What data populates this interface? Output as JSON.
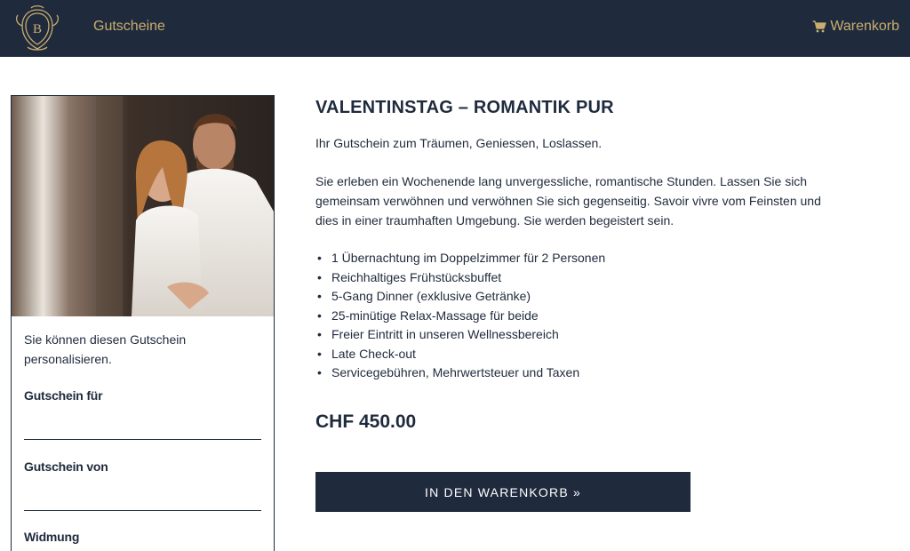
{
  "colors": {
    "nav_bg": "#1f2b3d",
    "accent_gold": "#c9ad6e",
    "text": "#1f2a3c",
    "button_bg": "#1f2b3d"
  },
  "header": {
    "logo_letter": "B",
    "nav_label": "Gutscheine",
    "cart_icon": "shopping-cart-icon",
    "cart_label": "Warenkorb"
  },
  "voucher_form": {
    "personalize_text": "Sie können diesen Gutschein personalisieren.",
    "for_label": "Gutschein für",
    "for_value": "",
    "from_label": "Gutschein von",
    "from_value": "",
    "dedication_label": "Widmung"
  },
  "product": {
    "title": "VALENTINSTAG – ROMANTIK PUR",
    "intro": "Ihr Gutschein zum Träumen, Geniessen, Loslassen.",
    "description": "Sie erleben ein Wochenende lang unvergessliche, romantische Stunden. Lassen Sie sich gemeinsam verwöhnen und verwöhnen Sie sich gegenseitig. Savoir vivre vom Feinsten und dies in einer traumhaften Umgebung. Sie werden begeistert sein.",
    "features": [
      "1 Übernachtung im Doppelzimmer für 2 Personen",
      "Reichhaltiges Frühstücksbuffet",
      "5-Gang Dinner (exklusive Getränke)",
      "25-minütige Relax-Massage für beide",
      "Freier Eintritt in unseren Wellnessbereich",
      "Late Check-out",
      "Servicegebühren, Mehrwertsteuer und Taxen"
    ],
    "price": "CHF 450.00",
    "add_to_cart_label": "IN DEN WARENKORB »"
  }
}
